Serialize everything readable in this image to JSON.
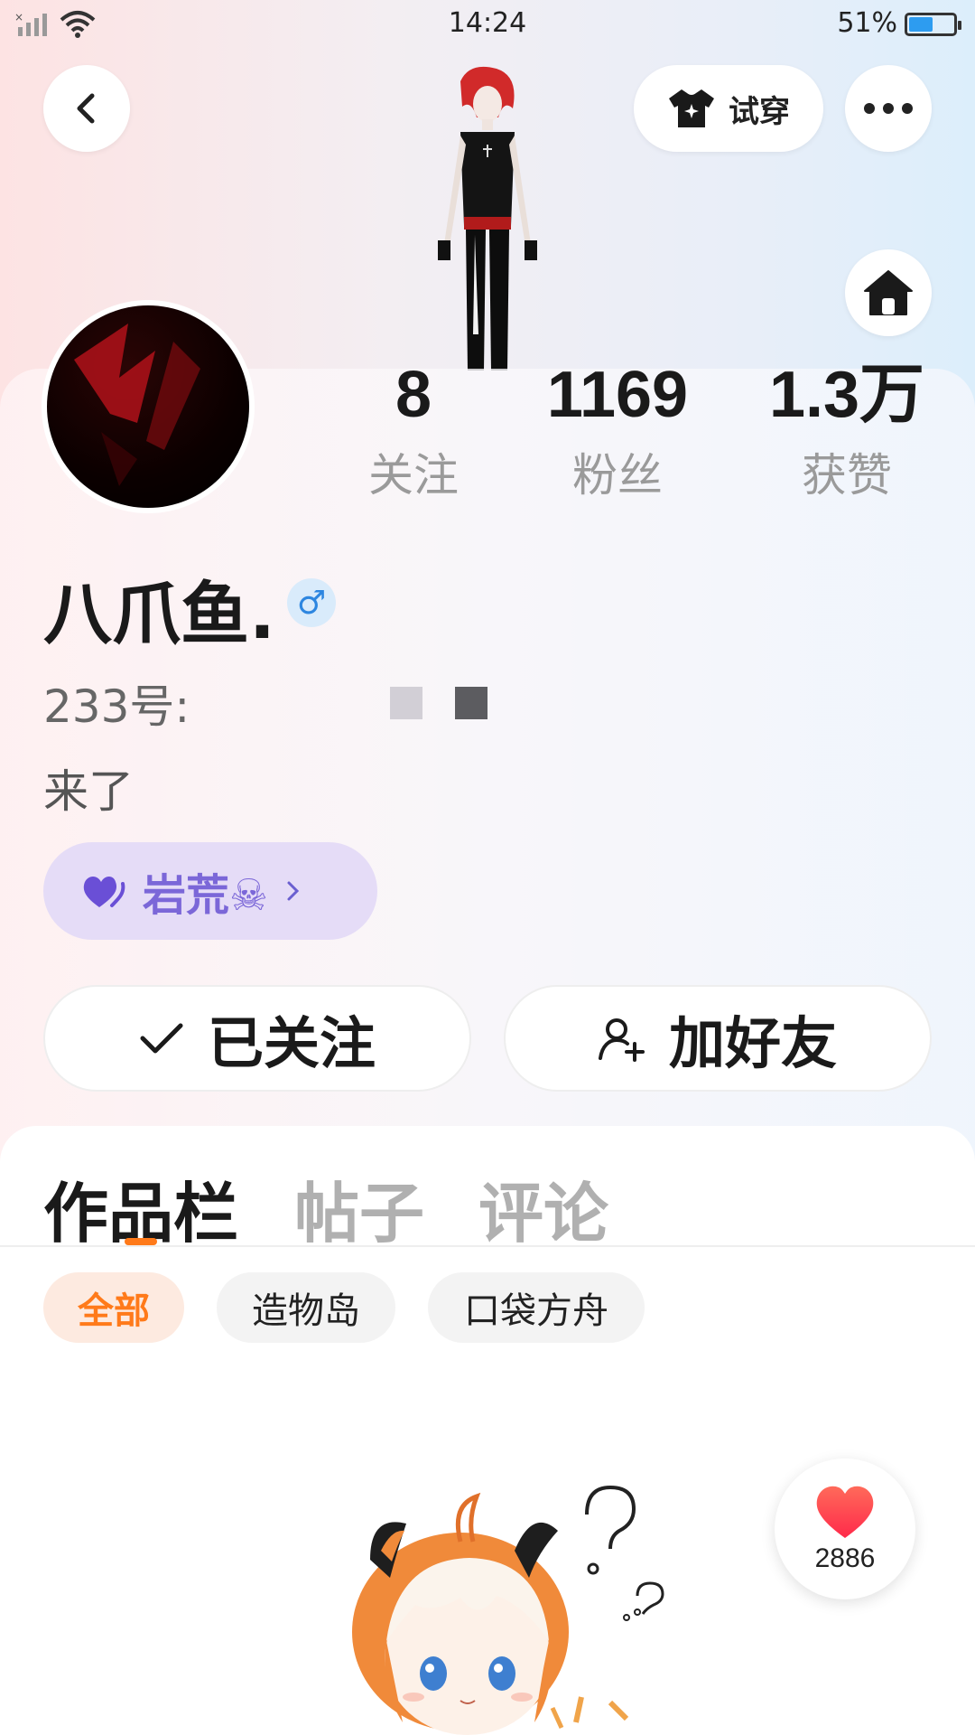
{
  "status_bar": {
    "time": "14:24",
    "battery_percent": "51%",
    "battery_level": 0.51,
    "icons": [
      "signal-icon",
      "wifi-icon",
      "battery-icon"
    ]
  },
  "header": {
    "try_on_label": "试穿",
    "icons": [
      "back-icon",
      "shirt-icon",
      "more-icon",
      "home-icon"
    ]
  },
  "profile": {
    "stats": [
      {
        "value": "8",
        "label": "关注"
      },
      {
        "value": "1169",
        "label": "粉丝"
      },
      {
        "value": "1.3万",
        "label": "获赞"
      }
    ],
    "name": "八爪鱼.",
    "gender_symbol": "♂",
    "id_label": "233号:",
    "bio": "来了",
    "tag": {
      "label": "岩荒☠",
      "icon": "heart-icon"
    }
  },
  "actions": {
    "following_label": "已关注",
    "add_friend_label": "加好友"
  },
  "tabs": [
    {
      "label": "作品栏",
      "active": true
    },
    {
      "label": "帖子",
      "active": false
    },
    {
      "label": "评论",
      "active": false
    }
  ],
  "filters": [
    {
      "label": "全部",
      "active": true
    },
    {
      "label": "造物岛",
      "active": false
    },
    {
      "label": "口袋方舟",
      "active": false
    }
  ],
  "like_button": {
    "count": "2886"
  },
  "colors": {
    "accent": "#ff7a1a",
    "tag_text": "#7b67d8",
    "tag_bg": "#e5dcf7",
    "gender_bg": "#d9ebfb",
    "heart": "#ff3b4f"
  }
}
